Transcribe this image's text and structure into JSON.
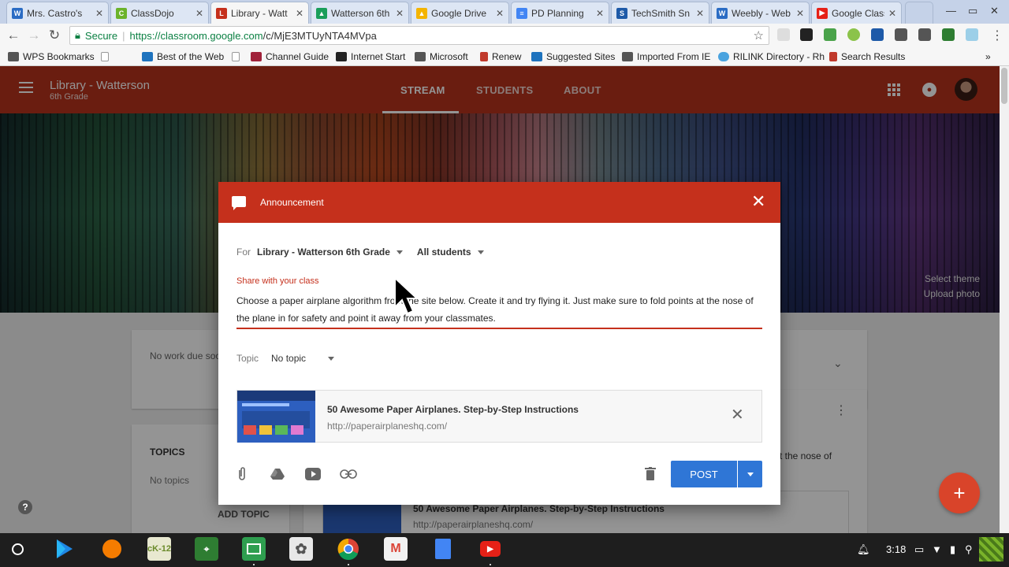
{
  "browser": {
    "tabs": [
      {
        "title": "Mrs. Castro's",
        "color": "#2b6cc4",
        "glyph": "W"
      },
      {
        "title": "ClassDojo",
        "color": "#6bb32a",
        "glyph": "C"
      },
      {
        "title": "Library - Watt",
        "color": "#c5301c",
        "glyph": "L",
        "active": true
      },
      {
        "title": "Watterson 6th",
        "color": "#1a9e5a",
        "glyph": "▲"
      },
      {
        "title": "Google Drive",
        "color": "#f4b400",
        "glyph": "▲"
      },
      {
        "title": "PD Planning",
        "color": "#4285f4",
        "glyph": "≡"
      },
      {
        "title": "TechSmith Sn",
        "color": "#1e5aa8",
        "glyph": "S"
      },
      {
        "title": "Weebly - Web",
        "color": "#2b6cc4",
        "glyph": "W"
      },
      {
        "title": "Google Class",
        "color": "#e62117",
        "glyph": "▶"
      }
    ],
    "address": {
      "secure_label": "Secure",
      "url_host": "https://classroom.google.com",
      "url_path": "/c/MjE3MTUyNTA4MVpa"
    },
    "bookmarks": [
      {
        "label": "WPS Bookmarks",
        "color": "#555"
      },
      {
        "label": "",
        "color": "#999"
      },
      {
        "label": "Best of the Web",
        "color": "#1e73be"
      },
      {
        "label": "",
        "color": "#999"
      },
      {
        "label": "Channel Guide",
        "color": "#a0223a"
      },
      {
        "label": "Internet Start",
        "color": "#222"
      },
      {
        "label": "Microsoft",
        "color": "#555"
      },
      {
        "label": "Renew",
        "color": "#c0392b"
      },
      {
        "label": "Suggested Sites",
        "color": "#1e73be"
      },
      {
        "label": "Imported From IE",
        "color": "#555"
      },
      {
        "label": "RILINK Directory - Rh",
        "color": "#4aa3df"
      },
      {
        "label": "Search Results",
        "color": "#c0392b"
      }
    ],
    "bookmarks_more": "»"
  },
  "classroom": {
    "class_title": "Library - Watterson",
    "class_subtitle": "6th Grade",
    "nav_tabs": [
      "STREAM",
      "STUDENTS",
      "ABOUT"
    ],
    "banner_links": [
      "Select theme",
      "Upload photo"
    ],
    "upcoming_text": "No work due soon",
    "topics_heading": "TOPICS",
    "no_topics": "No topics",
    "add_topic": "ADD TOPIC",
    "bg_post_tail": "t the nose of",
    "bg_attachment_title": "50 Awesome Paper Airplanes. Step-by-Step Instructions",
    "bg_attachment_url": "http://paperairplaneshq.com/",
    "fab_label": "+",
    "help_label": "?"
  },
  "dialog": {
    "title": "Announcement",
    "close_glyph": "✕",
    "for_label": "For",
    "class_select": "Library - Watterson 6th Grade",
    "students_select": "All students",
    "share_label": "Share with your class",
    "message": "Choose a paper airplane algorithm from the site below. Create it and try flying it. Just make sure to fold points at the nose of the plane in for safety and point it away from your classmates.",
    "topic_label": "Topic",
    "topic_value": "No topic",
    "attachment": {
      "title": "50 Awesome Paper Airplanes. Step-by-Step Instructions",
      "url": "http://paperairplaneshq.com/"
    },
    "post_label": "POST"
  },
  "taskbar": {
    "apps": [
      {
        "name": "Play Store",
        "color": "#1e88e5",
        "glyph": "▶"
      },
      {
        "name": "App",
        "color": "#f57c00",
        "glyph": "●"
      },
      {
        "name": "CK-12",
        "color": "#e8e8d0",
        "glyph": "cK-12"
      },
      {
        "name": "Maps",
        "color": "#2e7d32",
        "glyph": "⌖"
      },
      {
        "name": "Classroom",
        "color": "#2e9e4f",
        "glyph": "▣"
      },
      {
        "name": "Tree",
        "color": "#e8e8e8",
        "glyph": "✿"
      },
      {
        "name": "Chrome",
        "color": "#db4437",
        "glyph": "◉"
      },
      {
        "name": "Gmail",
        "color": "#f2f2f2",
        "glyph": "M"
      },
      {
        "name": "Docs",
        "color": "#4285f4",
        "glyph": "≡"
      },
      {
        "name": "YouTube",
        "color": "#e62117",
        "glyph": "▶"
      }
    ],
    "clock": "3:18"
  }
}
